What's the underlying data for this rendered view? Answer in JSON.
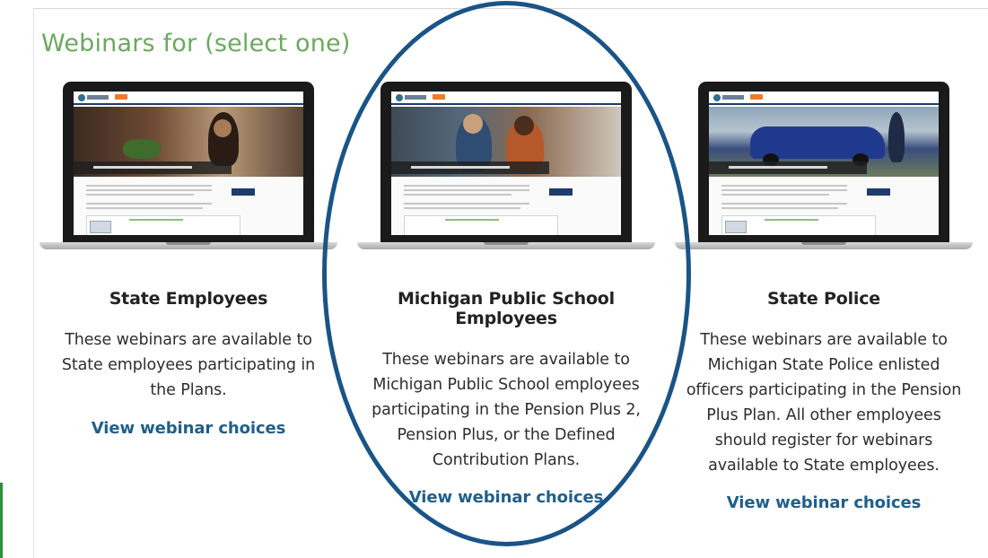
{
  "page": {
    "title": "Webinars for (select one)"
  },
  "colors": {
    "title_green": "#6aaa5c",
    "link_blue": "#1f5f8b",
    "ellipse_blue": "#1a5487",
    "left_edge_green": "#2f8f3a"
  },
  "cards": [
    {
      "heading": "State Employees",
      "description": "These webinars are available to State employees participating in the Plans.",
      "link": "View webinar choices",
      "preview_icon": "laptop-webinar-preview"
    },
    {
      "heading": "Michigan Public School Employees",
      "description": "These webinars are available to Michigan Public School employees participating in the Pension Plus 2, Pension Plus, or the Defined Contribution Plans.",
      "link": "View webinar choices",
      "preview_icon": "laptop-webinar-preview",
      "highlighted": true
    },
    {
      "heading": "State Police",
      "description": "These webinars are available to Michigan State Police enlisted officers participating in the Pension Plus Plan. All other employees should register for webinars available to State employees.",
      "link": "View webinar choices",
      "preview_icon": "laptop-webinar-preview"
    }
  ]
}
